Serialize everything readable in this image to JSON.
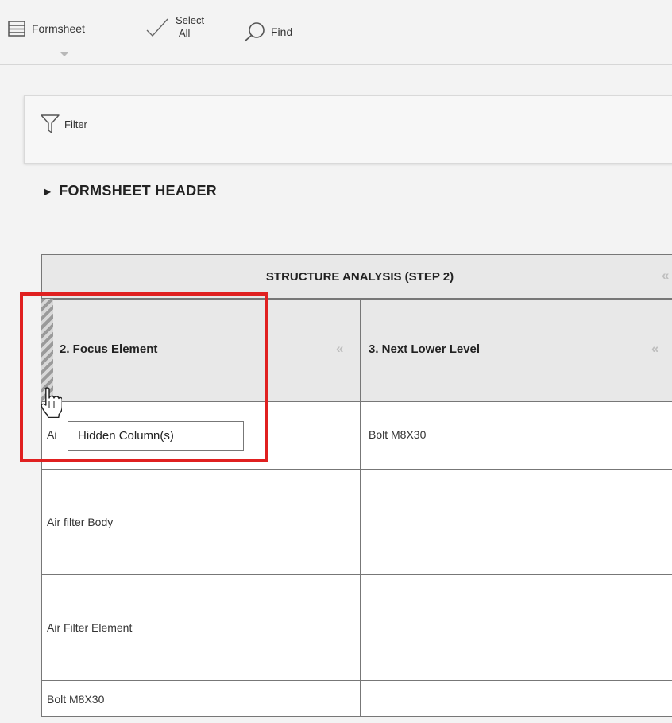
{
  "toolbar": {
    "formsheet_label": "Formsheet",
    "select_line1": "Select",
    "select_line2": "All",
    "find_label": "Find"
  },
  "filter": {
    "label": "Filter"
  },
  "section": {
    "title": "FORMSHEET HEADER"
  },
  "table": {
    "group_title": "STRUCTURE ANALYSIS (STEP 2)",
    "collapse_glyph": "«",
    "columns": [
      {
        "title": "2. Focus Element"
      },
      {
        "title": "3. Next Lower Level"
      }
    ],
    "rows": [
      [
        "Ai",
        "Bolt M8X30"
      ],
      [
        "Air filter Body",
        ""
      ],
      [
        "Air Filter Element",
        ""
      ],
      [
        "Bolt M8X30",
        ""
      ]
    ]
  },
  "tooltip": {
    "text": "Hidden Column(s)"
  },
  "colors": {
    "highlight": "#e02020",
    "header_bg": "#e8e8e8"
  },
  "icons": [
    "formsheet-icon",
    "checkmark-icon",
    "search-icon",
    "filter-icon",
    "hand-cursor-icon"
  ]
}
